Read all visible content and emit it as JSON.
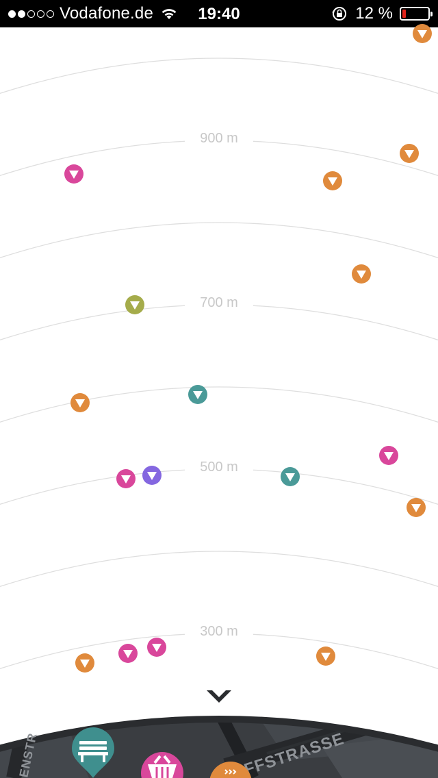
{
  "status_bar": {
    "carrier": "Vodafone.de",
    "time": "19:40",
    "battery_percent": "12 %",
    "signal_bars_filled": 2,
    "signal_bars_total": 5
  },
  "distance_labels": [
    {
      "text": "900 m"
    },
    {
      "text": "700 m"
    },
    {
      "text": "500 m"
    },
    {
      "text": "300 m"
    }
  ],
  "pois": [
    {
      "color": "#e08a3c",
      "category": "orange"
    },
    {
      "color": "#e08a3c",
      "category": "orange"
    },
    {
      "color": "#e08a3c",
      "category": "orange"
    },
    {
      "color": "#d9479b",
      "category": "pink"
    },
    {
      "color": "#e08a3c",
      "category": "orange"
    },
    {
      "color": "#a5ac4b",
      "category": "olive"
    },
    {
      "color": "#4a9a98",
      "category": "teal"
    },
    {
      "color": "#e08a3c",
      "category": "orange"
    },
    {
      "color": "#d9479b",
      "category": "pink"
    },
    {
      "color": "#d9479b",
      "category": "pink"
    },
    {
      "color": "#8467e0",
      "category": "purple"
    },
    {
      "color": "#4a9a98",
      "category": "teal"
    },
    {
      "color": "#e08a3c",
      "category": "orange"
    },
    {
      "color": "#d9479b",
      "category": "pink"
    },
    {
      "color": "#d9479b",
      "category": "pink"
    },
    {
      "color": "#e08a3c",
      "category": "orange"
    },
    {
      "color": "#e08a3c",
      "category": "orange"
    }
  ],
  "map": {
    "street_1": "FFSTRASSE",
    "street_2": "ENSTR",
    "bench_pin_color": "#3f8f8e",
    "basket_pin_color": "#d9479b",
    "heat_pin_color": "#e08a3c"
  },
  "colors": {
    "ring_line": "#d6d6d6",
    "map_background": "#3a3d41"
  }
}
